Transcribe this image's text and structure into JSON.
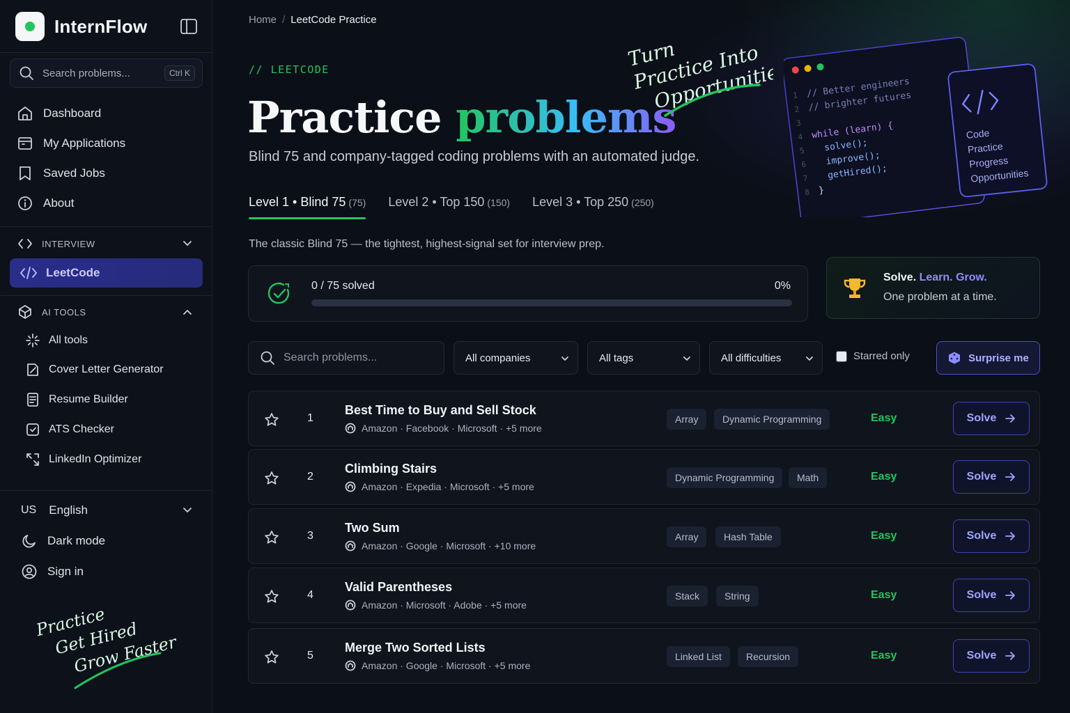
{
  "sidebar": {
    "brand": "InternFlow",
    "search": {
      "placeholder": "Search problems...",
      "shortcut": "Ctrl K"
    },
    "nav": [
      {
        "label": "Dashboard",
        "icon": "home-icon"
      },
      {
        "label": "My Applications",
        "icon": "inbox-icon"
      },
      {
        "label": "Saved Jobs",
        "icon": "bookmark-icon"
      },
      {
        "label": "About",
        "icon": "info-icon"
      }
    ],
    "interview": {
      "label": "INTERVIEW",
      "item": "LeetCode"
    },
    "ai_tools": {
      "label": "AI TOOLS",
      "items": [
        {
          "label": "All tools",
          "icon": "sparkle-icon"
        },
        {
          "label": "Cover Letter Generator",
          "icon": "edit-doc-icon"
        },
        {
          "label": "Resume Builder",
          "icon": "resume-icon"
        },
        {
          "label": "ATS Checker",
          "icon": "scan-icon"
        },
        {
          "label": "LinkedIn Optimizer",
          "icon": "share-icon"
        }
      ]
    },
    "language": {
      "code": "US",
      "label": "English"
    },
    "dark_mode": "Dark mode",
    "sign_in": "Sign in",
    "script": [
      "Practice",
      "Get Hired",
      "Grow Faster"
    ]
  },
  "main": {
    "breadcrumb": {
      "home": "Home",
      "sep": "/",
      "current": "LeetCode Practice"
    },
    "eyebrow": "// LEETCODE",
    "title": {
      "part1": "Practice ",
      "part2": "problems"
    },
    "subtitle": "Blind 75 and company-tagged coding problems with an automated judge.",
    "hero_script": [
      "Turn",
      "Practice Into",
      "Opportunities"
    ],
    "code_card": {
      "lines": [
        "// Better engineers",
        "// brighter futures",
        "",
        "while (learn) {",
        "  solve();",
        "  improve();",
        "  getHired();",
        "}"
      ],
      "side_labels": [
        "Code",
        "Practice",
        "Progress",
        "Opportunities"
      ]
    },
    "tabs": [
      {
        "label": "Level 1 • Blind 75",
        "count": "(75)",
        "active": true
      },
      {
        "label": "Level 2 • Top 150",
        "count": "(150)",
        "active": false
      },
      {
        "label": "Level 3 • Top 250",
        "count": "(250)",
        "active": false
      }
    ],
    "level_desc": "The classic Blind 75 — the tightest, highest-signal set for interview prep.",
    "progress": {
      "label": "0 / 75 solved",
      "percent_label": "0%",
      "fraction": 0
    },
    "motto": {
      "w1": "Solve.",
      "w2": "Learn.",
      "w3": "Grow.",
      "line2": "One problem at a time."
    },
    "filters": {
      "search_placeholder": "Search problems...",
      "companies": "All companies",
      "tags": "All tags",
      "difficulties": "All difficulties",
      "starred": "Starred only",
      "surprise": "Surprise me"
    },
    "problems": [
      {
        "num": "1",
        "title": "Best Time to Buy and Sell Stock",
        "companies": "Amazon · Facebook · Microsoft · +5 more",
        "tags": [
          "Array",
          "Dynamic Programming"
        ],
        "difficulty": "Easy",
        "action": "Solve"
      },
      {
        "num": "2",
        "title": "Climbing Stairs",
        "companies": "Amazon · Expedia · Microsoft · +5 more",
        "tags": [
          "Dynamic Programming",
          "Math"
        ],
        "difficulty": "Easy",
        "action": "Solve"
      },
      {
        "num": "3",
        "title": "Two Sum",
        "companies": "Amazon · Google · Microsoft · +10 more",
        "tags": [
          "Array",
          "Hash Table"
        ],
        "difficulty": "Easy",
        "action": "Solve"
      },
      {
        "num": "4",
        "title": "Valid Parentheses",
        "companies": "Amazon · Microsoft · Adobe · +5 more",
        "tags": [
          "Stack",
          "String"
        ],
        "difficulty": "Easy",
        "action": "Solve"
      },
      {
        "num": "5",
        "title": "Merge Two Sorted Lists",
        "companies": "Amazon · Google · Microsoft · +5 more",
        "tags": [
          "Linked List",
          "Recursion"
        ],
        "difficulty": "Easy",
        "action": "Solve"
      }
    ]
  },
  "colors": {
    "accent_green": "#22c55e",
    "accent_indigo": "#8d8cff",
    "background": "#0b0f17"
  }
}
